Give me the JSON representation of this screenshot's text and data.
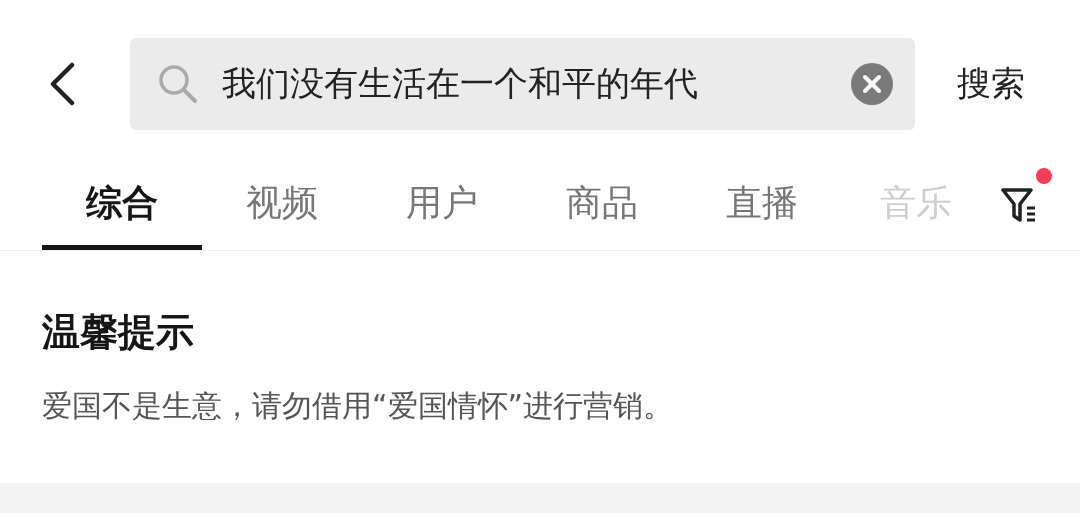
{
  "search": {
    "value": "我们没有生活在一个和平的年代",
    "button": "搜索"
  },
  "tabs": [
    {
      "label": "综合",
      "selected": true
    },
    {
      "label": "视频",
      "selected": false
    },
    {
      "label": "用户",
      "selected": false
    },
    {
      "label": "商品",
      "selected": false
    },
    {
      "label": "直播",
      "selected": false
    },
    {
      "label": "音乐",
      "selected": false
    }
  ],
  "filter": {
    "badge": true
  },
  "notice": {
    "title": "温馨提示",
    "text": "爱国不是生意，请勿借用“爱国情怀”进行营销。"
  }
}
